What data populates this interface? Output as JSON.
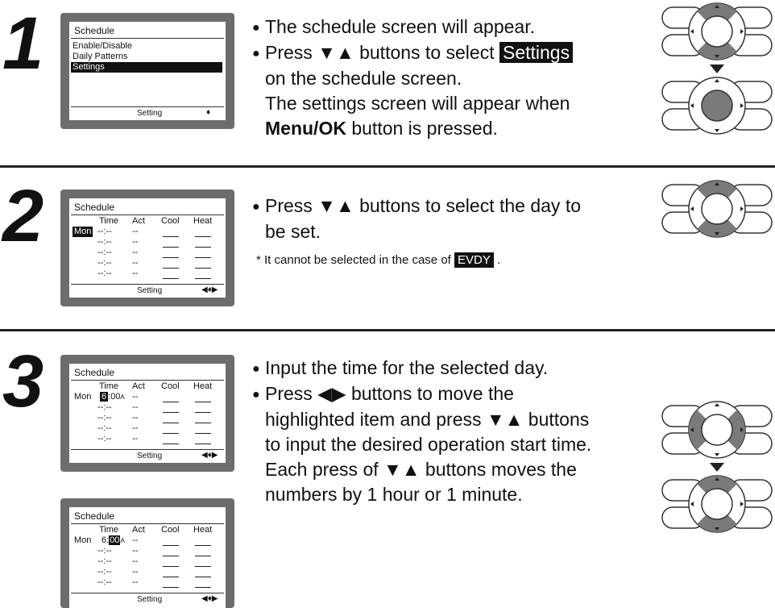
{
  "steps": [
    {
      "number": "1",
      "screen": {
        "title": "Schedule",
        "items": [
          "Enable/Disable",
          "Daily Patterns",
          "Settings"
        ],
        "selected": "Settings",
        "footer": "Setting",
        "footer_icon": "♦"
      },
      "bullets": [
        {
          "text": "The schedule screen will appear."
        },
        {
          "pre": "Press ▼▲ buttons to select ",
          "tag": "Settings",
          "line2": "on the schedule screen.",
          "line3": "The settings screen will appear when",
          "bold": "Menu/OK",
          "line4": " button is pressed."
        }
      ]
    },
    {
      "number": "2",
      "screen": {
        "title": "Schedule",
        "headers": [
          "Time",
          "Act",
          "Cool",
          "Heat"
        ],
        "day": "Mon",
        "time_blank": "--:--",
        "act_blank": "--",
        "footer": "Setting",
        "footer_icon": "◀♦▶"
      },
      "bullets": [
        {
          "line1": "Press ▼▲ buttons to select the day to",
          "line2": "be set."
        }
      ],
      "note_pre": "* It cannot be selected in the case of ",
      "note_tag": "EVDY",
      "note_post": " ."
    },
    {
      "number": "3",
      "screen_a": {
        "title": "Schedule",
        "headers": [
          "Time",
          "Act",
          "Cool",
          "Heat"
        ],
        "day": "Mon",
        "hour": "6",
        "min": ":00",
        "ampm": "A",
        "time_blank": "--:--",
        "act_blank": "--",
        "footer": "Setting",
        "footer_icon": "◀♦▶"
      },
      "screen_b": {
        "title": "Schedule",
        "headers": [
          "Time",
          "Act",
          "Cool",
          "Heat"
        ],
        "day": "Mon",
        "hour": "6",
        "sep": ":",
        "min": "00",
        "ampm": "A",
        "time_blank": "--:--",
        "act_blank": "--",
        "footer": "Setting",
        "footer_icon": "◀♦▶"
      },
      "bullets": [
        {
          "text": "Input the time for the selected day."
        },
        {
          "lines": [
            "Press ◀▶ buttons to move the",
            "highlighted item and press ▼▲ buttons",
            "to input the desired operation start time.",
            "Each press of ▼▲ buttons moves the",
            "numbers by 1 hour or 1 minute."
          ]
        }
      ]
    }
  ],
  "colors": {
    "highlight": "#111111",
    "pad_active": "#7a7a7a",
    "lcd_frame": "#6d6d6d"
  }
}
